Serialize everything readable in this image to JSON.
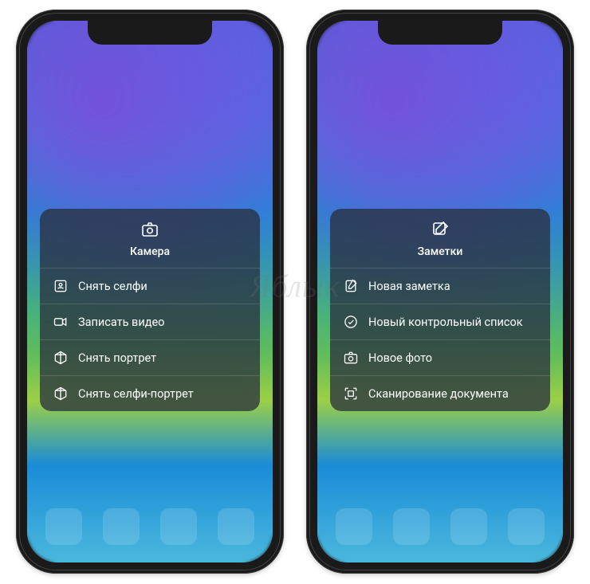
{
  "watermark": "Яблык",
  "phones": [
    {
      "menu": {
        "title": "Камера",
        "icon": "camera-icon",
        "items": [
          {
            "icon": "selfie-icon",
            "label": "Снять селфи"
          },
          {
            "icon": "video-icon",
            "label": "Записать видео"
          },
          {
            "icon": "portrait-icon",
            "label": "Снять портрет"
          },
          {
            "icon": "portrait-icon",
            "label": "Снять селфи-портрет"
          }
        ]
      }
    },
    {
      "menu": {
        "title": "Заметки",
        "icon": "compose-icon",
        "items": [
          {
            "icon": "note-icon",
            "label": "Новая заметка"
          },
          {
            "icon": "checklist-icon",
            "label": "Новый контрольный список"
          },
          {
            "icon": "camera-icon",
            "label": "Новое фото"
          },
          {
            "icon": "scan-icon",
            "label": "Сканирование документа"
          }
        ]
      }
    }
  ]
}
